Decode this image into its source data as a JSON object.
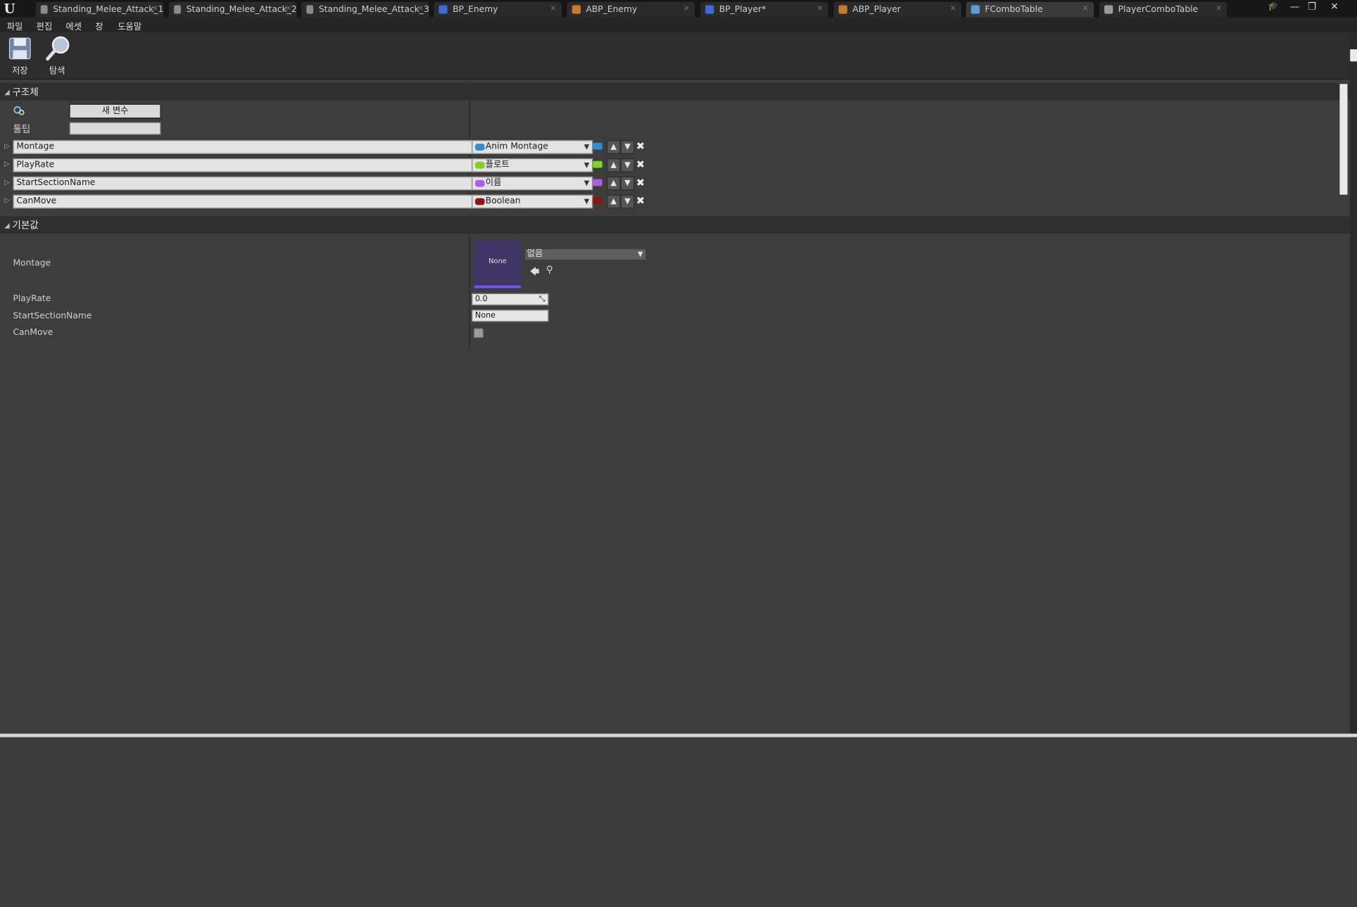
{
  "window": {
    "logo": "U",
    "tabs": [
      {
        "label": "Standing_Melee_Attack_1",
        "icon": "sequence-asset-icon",
        "color": "#8a8a8a"
      },
      {
        "label": "Standing_Melee_Attack_2",
        "icon": "sequence-asset-icon",
        "color": "#8a8a8a"
      },
      {
        "label": "Standing_Melee_Attack_3",
        "icon": "sequence-asset-icon",
        "color": "#8a8a8a"
      },
      {
        "label": "BP_Enemy",
        "icon": "blueprint-icon",
        "color": "#3f6ad8"
      },
      {
        "label": "ABP_Enemy",
        "icon": "anim-blueprint-icon",
        "color": "#c47c2a"
      },
      {
        "label": "BP_Player*",
        "icon": "blueprint-icon",
        "color": "#3f6ad8"
      },
      {
        "label": "ABP_Player",
        "icon": "anim-blueprint-icon",
        "color": "#c47c2a"
      },
      {
        "label": "FComboTable",
        "icon": "struct-icon",
        "color": "#5aa0d8"
      },
      {
        "label": "PlayerComboTable",
        "icon": "data-table-icon",
        "color": "#9a9a9a"
      }
    ],
    "close_glyph": "×",
    "controls": {
      "minimize": "—",
      "restore": "❐",
      "close": "✕"
    }
  },
  "menu": [
    "파일",
    "편집",
    "에셋",
    "창",
    "도움말"
  ],
  "toolbar": {
    "save_label": "저장",
    "browse_label": "탐색"
  },
  "structure": {
    "title": "구조체",
    "new_variable_label": "새 변수",
    "tooltip_label": "툴팁",
    "tooltip_value": "",
    "variables": [
      {
        "name": "Montage",
        "type": "Anim Montage",
        "color": "#2a8fd6"
      },
      {
        "name": "PlayRate",
        "type": "플로트",
        "color": "#7ed321"
      },
      {
        "name": "StartSectionName",
        "type": "이름",
        "color": "#b05ee0"
      },
      {
        "name": "CanMove",
        "type": "Boolean",
        "color": "#8c1414"
      }
    ]
  },
  "defaults": {
    "title": "기본값",
    "montage_label": "Montage",
    "montage_thumb": "None",
    "montage_value": "없음",
    "playrate_label": "PlayRate",
    "playrate_value": "0.0",
    "startsection_label": "StartSectionName",
    "startsection_value": "None",
    "canmove_label": "CanMove",
    "canmove_checked": false
  }
}
